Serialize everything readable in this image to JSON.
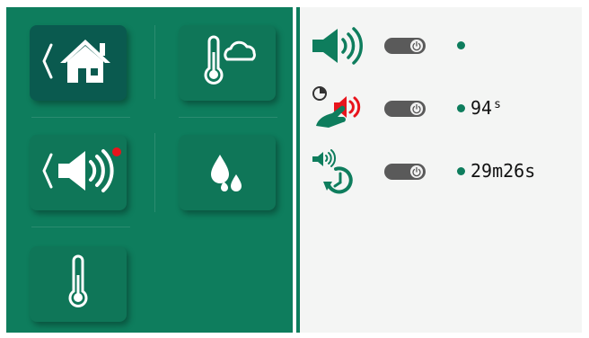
{
  "colors": {
    "panel_green": "#0e7d5d",
    "tile_green": "#0f7658",
    "tile_active": "#0a5a4f",
    "alert_red": "#e8141c",
    "status_dot": "#0e7d5d"
  },
  "tiles": [
    {
      "name": "home",
      "icon": "back-home-icon",
      "active": true
    },
    {
      "name": "outdoor-temperature",
      "icon": "thermometer-cloud-icon",
      "active": false
    },
    {
      "name": "sound",
      "icon": "back-speaker-icon",
      "active": false,
      "badge": true
    },
    {
      "name": "humidity",
      "icon": "water-drops-icon",
      "active": false
    },
    {
      "name": "temperature",
      "icon": "thermometer-icon",
      "active": false
    }
  ],
  "rows": [
    {
      "icon": "speaker-on-icon",
      "toggle": "power-toggle",
      "value": "",
      "unit": ""
    },
    {
      "icon": "timer-touch-alarm-icon",
      "toggle": "power-toggle",
      "value": "94",
      "unit": "s"
    },
    {
      "icon": "speaker-repeat-icon",
      "toggle": "power-toggle",
      "value": "29m26s",
      "unit": ""
    }
  ]
}
